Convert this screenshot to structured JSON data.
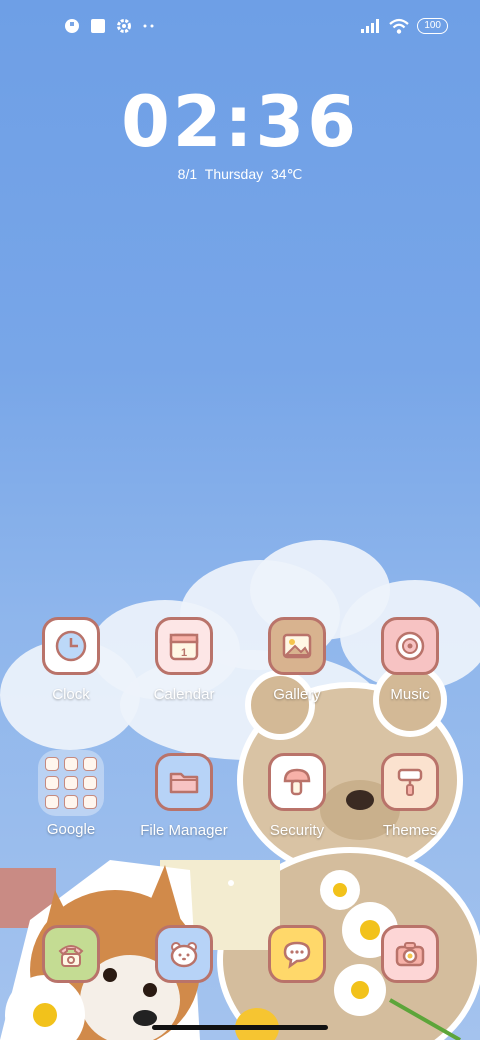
{
  "status_bar": {
    "left_icons": [
      "app-notification-icon",
      "square-notification-icon",
      "gear-icon",
      "more-dots-icon"
    ],
    "right_icons": [
      "signal-icon",
      "wifi-icon"
    ],
    "battery": "100"
  },
  "lockclock": {
    "time": "02:36",
    "date": "8/1  Thursday   34℃"
  },
  "apps": {
    "clock": "Clock",
    "calendar": "Calendar",
    "calendar_day": "1",
    "gallery": "Gallery",
    "music": "Music",
    "google": "Google",
    "file_manager": "File Manager",
    "security": "Security",
    "themes": "Themes"
  },
  "dock": [
    "phone-icon",
    "messenger-bear-icon",
    "messages-icon",
    "camera-icon"
  ],
  "colors": {
    "tile_border": "#b9736a",
    "clock_tile": "#ffffff",
    "calendar_tile": "#fde6e6",
    "gallery_tile": "#d8b38f",
    "music_tile": "#f7c3c3",
    "file_tile": "#b7d3f7",
    "security_tile": "#ffffff",
    "themes_tile": "#fbe2cf",
    "phone_tile": "#c4dc93",
    "bear_tile": "#b7d3f7",
    "msg_tile": "#ffd86a",
    "camera_tile": "#fdd6d6"
  }
}
